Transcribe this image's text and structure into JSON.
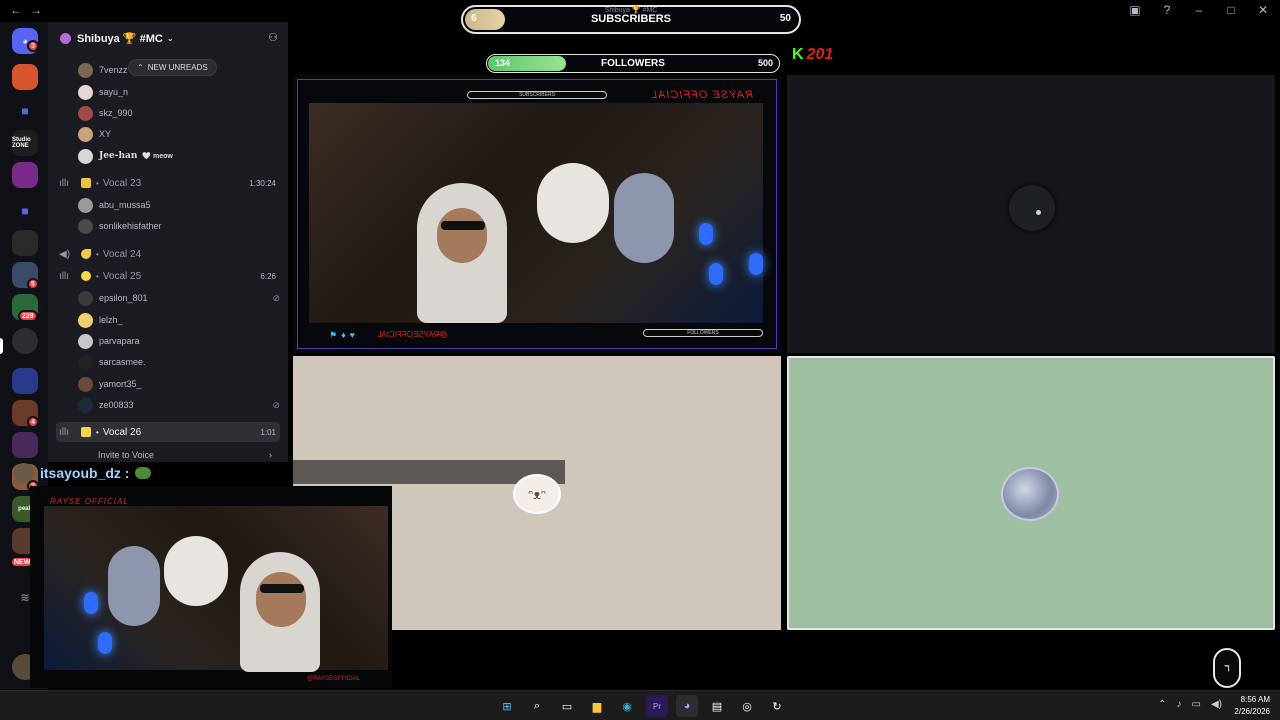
{
  "window": {
    "back_icon": "arrow-left-icon",
    "forward_icon": "arrow-right-icon",
    "controls": [
      "inbox-icon",
      "help-icon",
      "minimize-icon",
      "maximize-icon",
      "close-icon"
    ]
  },
  "server_rail": {
    "dm_badge": "3",
    "badges": [
      "5",
      "229",
      "4",
      "2",
      "NEW"
    ],
    "servers": [
      "Studio ZONE",
      "peak"
    ]
  },
  "server_header": {
    "name": "Shibuya 🏆 #MC",
    "accent": "#b76bd8"
  },
  "new_unreads": {
    "label": "NEW UNREADS"
  },
  "channels": {
    "top_users": [
      {
        "name": "7venzz",
        "color": "#7a6a52"
      },
      {
        "name": "sayu_n",
        "color": "#e7d6d6"
      },
      {
        "name": "skz_990",
        "color": "#a04a4a"
      },
      {
        "name": "XY",
        "color": "#c9a37a"
      },
      {
        "name": "Jee-han",
        "tag": "🤍 meow",
        "color": "#d8d8d8"
      }
    ],
    "vocal23": {
      "name": "Vocal 23",
      "time": "1:30:24",
      "emoji_color": "#f0c040",
      "users": [
        {
          "name": "abu_mussa5",
          "color": "#9a9a9a"
        },
        {
          "name": "sonlikehisfather",
          "color": "#4a4a4a"
        }
      ]
    },
    "vocal24": {
      "name": "Vocal 24",
      "emoji_color": "#f7c948"
    },
    "vocal25": {
      "name": "Vocal 25",
      "time": "6:26",
      "emoji_color": "#f7d648",
      "users": [
        {
          "name": "epsilon_801",
          "color": "#3a3a3a",
          "muted": true
        },
        {
          "name": "lelzh_",
          "color": "#f0d070"
        },
        {
          "name": "parvapara",
          "color": "#c8c8c8"
        },
        {
          "name": "sarcasmee.",
          "color": "#222222"
        },
        {
          "name": "yamort35_",
          "color": "#6a4a3a"
        },
        {
          "name": "ze00833",
          "color": "#202a3a",
          "muted": true
        }
      ]
    },
    "vocal26": {
      "name": "Vocal 26",
      "time": "1:01",
      "emoji_color": "#f7d648"
    },
    "invite": "Invite to Voice"
  },
  "stream_overlay": {
    "subscribers": {
      "label": "SUBSCRIBERS",
      "current": "6",
      "max": "50",
      "progress": 0.12,
      "mini": "Shibuya 🏆 #MC"
    },
    "followers": {
      "label": "FOLLOWERS",
      "current": "134",
      "max": "500",
      "progress": 0.268
    },
    "kick_count": "201",
    "channel_mirror": "RAYSE OFFICIAL",
    "handle_mirror": "@RAYSEOFFICIAL",
    "mini_subs": "SUBSCRIBERS",
    "mini_follows": "FOLLOWERS"
  },
  "pip": {
    "username": "itsayoub_dz :",
    "channel": "RAYSE OFFICIAL",
    "handle": "@RAYSEOFFICIAL"
  },
  "taskbar": {
    "apps": [
      "windows-start-icon",
      "search-icon",
      "task-view-icon",
      "file-explorer-icon",
      "edge-icon",
      "premiere-icon",
      "discord-icon",
      "terminal-icon",
      "obs-icon",
      "app-icon"
    ],
    "time": "8:56 AM",
    "date": "2/26/2026"
  },
  "colors": {
    "sidebar_bg": "#1a1c22",
    "rail_bg": "#0f1116",
    "kick_green": "#53fc18",
    "beige_tile": "#cfc6bc",
    "green_tile": "#9fbfa2"
  }
}
